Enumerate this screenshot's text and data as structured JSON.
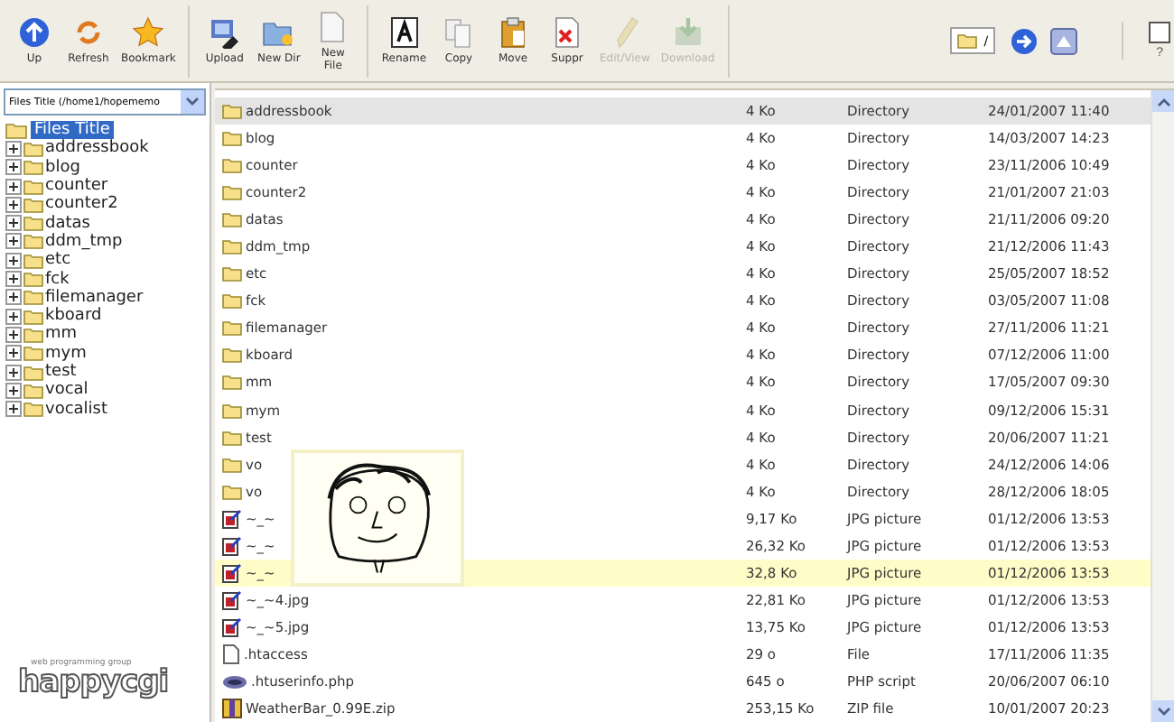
{
  "toolbar": {
    "groups": [
      [
        {
          "label": "Up",
          "disabled": false
        },
        {
          "label": "Refresh",
          "disabled": false
        },
        {
          "label": "Bookmark",
          "disabled": false
        }
      ],
      [
        {
          "label": "Upload",
          "disabled": false
        },
        {
          "label": "New Dir",
          "disabled": false
        },
        {
          "label": "New File",
          "disabled": false
        }
      ],
      [
        {
          "label": "Rename",
          "disabled": false
        },
        {
          "label": "Copy",
          "disabled": false
        },
        {
          "label": "Move",
          "disabled": false
        },
        {
          "label": "Suppr",
          "disabled": false
        },
        {
          "label": "Edit/View",
          "disabled": true
        },
        {
          "label": "Download",
          "disabled": true
        }
      ]
    ],
    "path": "/",
    "help": "?"
  },
  "sidebar": {
    "select": "Files Title (/home1/hopememo",
    "root": {
      "label": "Files Title",
      "selected": true
    },
    "items": [
      {
        "label": "addressbook",
        "expanded": false
      },
      {
        "label": "blog",
        "expanded": false
      },
      {
        "label": "counter",
        "expanded": false
      },
      {
        "label": "counter2",
        "expanded": false
      },
      {
        "label": "datas",
        "expanded": false
      },
      {
        "label": "ddm_tmp",
        "expanded": false
      },
      {
        "label": "etc",
        "expanded": false
      },
      {
        "label": "fck",
        "expanded": false
      },
      {
        "label": "filemanager",
        "expanded": false
      },
      {
        "label": "kboard",
        "expanded": false
      },
      {
        "label": "mm",
        "expanded": false
      },
      {
        "label": "mym",
        "expanded": false
      },
      {
        "label": "test",
        "expanded": false
      },
      {
        "label": "vocal",
        "expanded": false
      },
      {
        "label": "vocalist",
        "expanded": false
      }
    ],
    "logo_tagline": "web programming group",
    "logo": "happycgi"
  },
  "files": [
    {
      "kind": "folder",
      "name": "addressbook",
      "size": "4 Ko",
      "type": "Directory",
      "date": "24/01/2007 11:40",
      "selected": true,
      "hovered": false
    },
    {
      "kind": "folder",
      "name": "blog",
      "size": "4 Ko",
      "type": "Directory",
      "date": "14/03/2007 14:23",
      "selected": false,
      "hovered": false
    },
    {
      "kind": "folder",
      "name": "counter",
      "size": "4 Ko",
      "type": "Directory",
      "date": "23/11/2006 10:49",
      "selected": false,
      "hovered": false
    },
    {
      "kind": "folder",
      "name": "counter2",
      "size": "4 Ko",
      "type": "Directory",
      "date": "21/01/2007 21:03",
      "selected": false,
      "hovered": false
    },
    {
      "kind": "folder",
      "name": "datas",
      "size": "4 Ko",
      "type": "Directory",
      "date": "21/11/2006 09:20",
      "selected": false,
      "hovered": false
    },
    {
      "kind": "folder",
      "name": "ddm_tmp",
      "size": "4 Ko",
      "type": "Directory",
      "date": "21/12/2006 11:43",
      "selected": false,
      "hovered": false
    },
    {
      "kind": "folder",
      "name": "etc",
      "size": "4 Ko",
      "type": "Directory",
      "date": "25/05/2007 18:52",
      "selected": false,
      "hovered": false
    },
    {
      "kind": "folder",
      "name": "fck",
      "size": "4 Ko",
      "type": "Directory",
      "date": "03/05/2007 11:08",
      "selected": false,
      "hovered": false
    },
    {
      "kind": "folder",
      "name": "filemanager",
      "size": "4 Ko",
      "type": "Directory",
      "date": "27/11/2006 11:21",
      "selected": false,
      "hovered": false
    },
    {
      "kind": "folder",
      "name": "kboard",
      "size": "4 Ko",
      "type": "Directory",
      "date": "07/12/2006 11:00",
      "selected": false,
      "hovered": false
    },
    {
      "kind": "folder",
      "name": "mm",
      "size": "4 Ko",
      "type": "Directory",
      "date": "17/05/2007 09:30",
      "selected": false,
      "hovered": false
    },
    {
      "kind": "folder",
      "name": "mym",
      "size": "4 Ko",
      "type": "Directory",
      "date": "09/12/2006 15:31",
      "selected": false,
      "hovered": false
    },
    {
      "kind": "folder",
      "name": "test",
      "size": "4 Ko",
      "type": "Directory",
      "date": "20/06/2007 11:21",
      "selected": false,
      "hovered": false
    },
    {
      "kind": "folder",
      "name": "vo",
      "size": "4 Ko",
      "type": "Directory",
      "date": "24/12/2006 14:06",
      "selected": false,
      "hovered": false
    },
    {
      "kind": "folder",
      "name": "vo",
      "size": "4 Ko",
      "type": "Directory",
      "date": "28/12/2006 18:05",
      "selected": false,
      "hovered": false
    },
    {
      "kind": "image",
      "name": "~_~",
      "size": "9,17 Ko",
      "type": "JPG picture",
      "date": "01/12/2006 13:53",
      "selected": false,
      "hovered": false
    },
    {
      "kind": "image",
      "name": "~_~",
      "size": "26,32 Ko",
      "type": "JPG picture",
      "date": "01/12/2006 13:53",
      "selected": false,
      "hovered": false
    },
    {
      "kind": "image",
      "name": "~_~",
      "size": "32,8 Ko",
      "type": "JPG picture",
      "date": "01/12/2006 13:53",
      "selected": false,
      "hovered": true
    },
    {
      "kind": "image",
      "name": "~_~4.jpg",
      "size": "22,81 Ko",
      "type": "JPG picture",
      "date": "01/12/2006 13:53",
      "selected": false,
      "hovered": false
    },
    {
      "kind": "image",
      "name": "~_~5.jpg",
      "size": "13,75 Ko",
      "type": "JPG picture",
      "date": "01/12/2006 13:53",
      "selected": false,
      "hovered": false
    },
    {
      "kind": "file",
      "name": ".htaccess",
      "size": "29 o",
      "type": "File",
      "date": "17/11/2006 11:35",
      "selected": false,
      "hovered": false
    },
    {
      "kind": "php",
      "name": ".htuserinfo.php",
      "size": "645 o",
      "type": "PHP script",
      "date": "20/06/2007 06:10",
      "selected": false,
      "hovered": false
    },
    {
      "kind": "zip",
      "name": "WeatherBar_0.99E.zip",
      "size": "253,15 Ko",
      "type": "ZIP file",
      "date": "10/01/2007 20:23",
      "selected": false,
      "hovered": false
    }
  ]
}
